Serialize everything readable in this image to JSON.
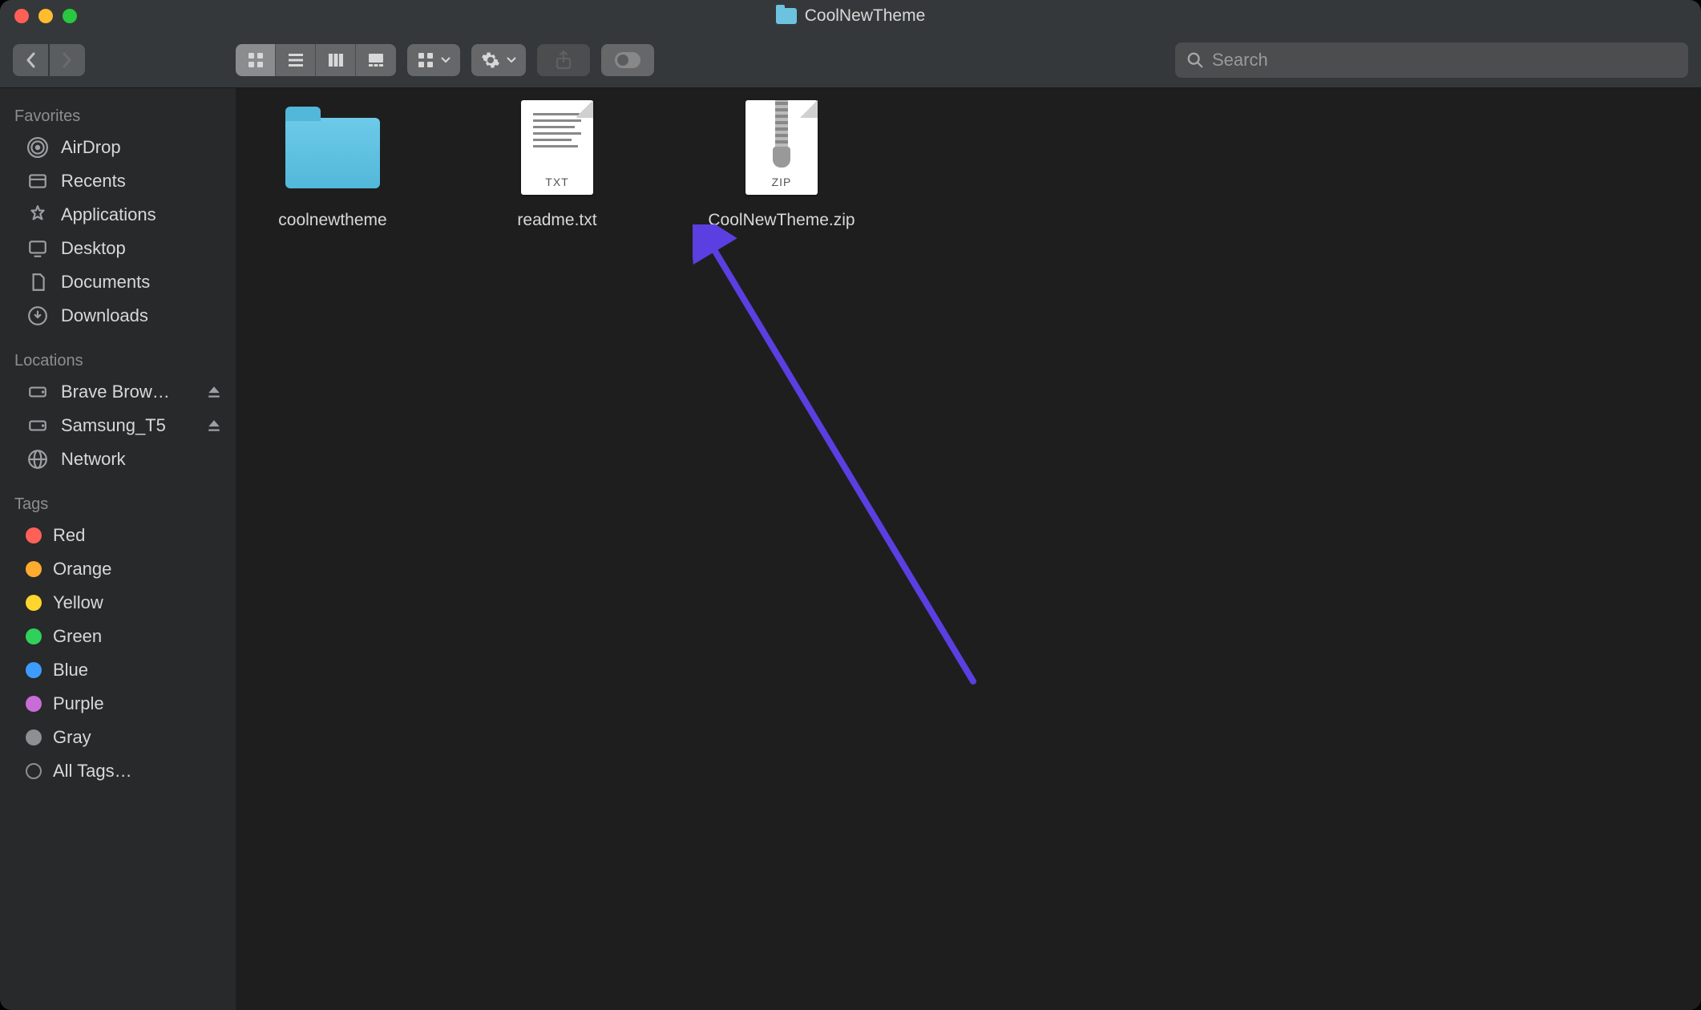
{
  "window": {
    "title": "CoolNewTheme"
  },
  "search": {
    "placeholder": "Search"
  },
  "sidebar": {
    "sections": {
      "favorites": {
        "header": "Favorites",
        "items": [
          {
            "label": "AirDrop"
          },
          {
            "label": "Recents"
          },
          {
            "label": "Applications"
          },
          {
            "label": "Desktop"
          },
          {
            "label": "Documents"
          },
          {
            "label": "Downloads"
          }
        ]
      },
      "locations": {
        "header": "Locations",
        "items": [
          {
            "label": "Brave Brow…"
          },
          {
            "label": "Samsung_T5"
          },
          {
            "label": "Network"
          }
        ]
      },
      "tags": {
        "header": "Tags",
        "items": [
          {
            "label": "Red",
            "color": "#ff6159"
          },
          {
            "label": "Orange",
            "color": "#ffab2e"
          },
          {
            "label": "Yellow",
            "color": "#ffd52e"
          },
          {
            "label": "Green",
            "color": "#2fd15b"
          },
          {
            "label": "Blue",
            "color": "#3c9dff"
          },
          {
            "label": "Purple",
            "color": "#c86dd7"
          },
          {
            "label": "Gray",
            "color": "#8e8e93"
          },
          {
            "label": "All Tags…"
          }
        ]
      }
    }
  },
  "files": [
    {
      "name": "coolnewtheme",
      "type": "folder"
    },
    {
      "name": "readme.txt",
      "type": "txt",
      "badge": "TXT"
    },
    {
      "name": "CoolNewTheme.zip",
      "type": "zip",
      "badge": "ZIP"
    }
  ]
}
